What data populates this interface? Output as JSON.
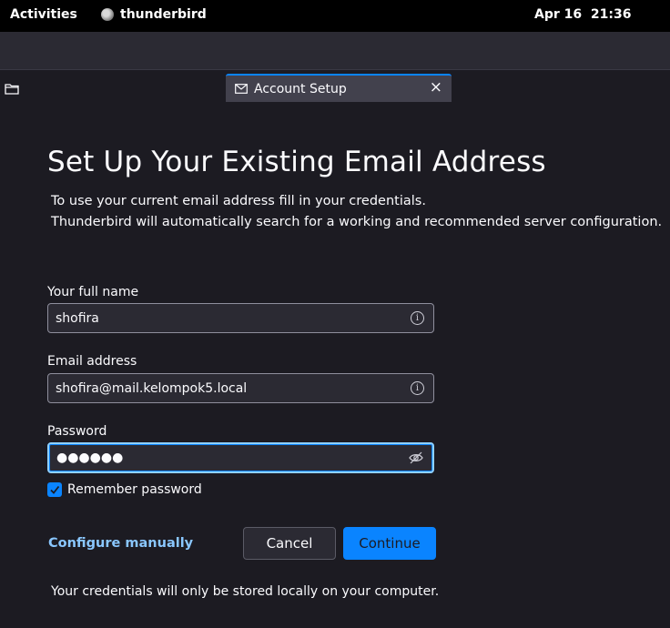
{
  "topbar": {
    "activities": "Activities",
    "app_name": "thunderbird",
    "clock": "Apr 16  21:36"
  },
  "tab": {
    "label": "Account Setup",
    "close": "×"
  },
  "form": {
    "title": "Set Up Your Existing Email Address",
    "intro_line1": "To use your current email address fill in your credentials.",
    "intro_line2": "Thunderbird will automatically search for a working and recommended server configuration.",
    "name_label": "Your full name",
    "name_value": "shofira",
    "email_label": "Email address",
    "email_value": "shofira@mail.kelompok5.local",
    "password_label": "Password",
    "password_mask": "●●●●●●",
    "remember_label": "Remember password",
    "remember_checked": true,
    "configure_manually": "Configure manually",
    "cancel": "Cancel",
    "continue": "Continue",
    "footer_note": "Your credentials will only be stored locally on your computer."
  },
  "colors": {
    "background": "#1c1b22",
    "accent": "#0a84ff",
    "link": "#8ac7ff"
  }
}
